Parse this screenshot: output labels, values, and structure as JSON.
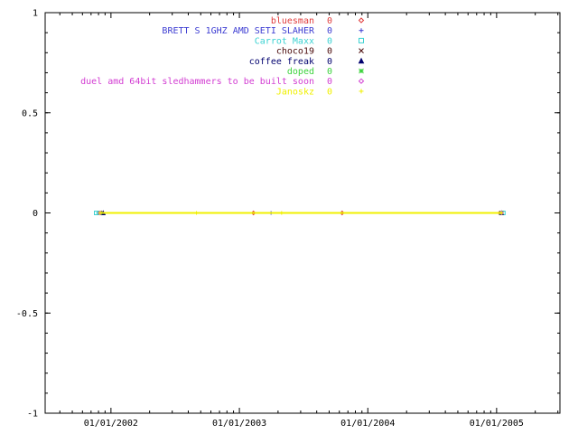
{
  "chart_data": {
    "type": "line",
    "title": "",
    "xlabel": "",
    "ylabel": "",
    "x_axis_type": "date",
    "x_range": [
      "2001-06-28",
      "2005-06-30"
    ],
    "ylim": [
      -1,
      1
    ],
    "grid": false,
    "legend_position": "top-right",
    "y_ticks": [
      {
        "value": 1,
        "label": "1"
      },
      {
        "value": 0.5,
        "label": "0.5"
      },
      {
        "value": 0,
        "label": "0"
      },
      {
        "value": -0.5,
        "label": "-0.5"
      },
      {
        "value": -1,
        "label": "-1"
      }
    ],
    "x_ticks": [
      {
        "date": "2002-01-01",
        "label": "01/01/2002"
      },
      {
        "date": "2003-01-01",
        "label": "01/01/2003"
      },
      {
        "date": "2004-01-01",
        "label": "01/01/2004"
      },
      {
        "date": "2005-01-01",
        "label": "01/01/2005"
      }
    ],
    "series": [
      {
        "name": "bluesman",
        "value_label": "0",
        "color": "#e03c3c",
        "marker": "diamond",
        "points": [
          [
            "2001-12-05",
            0
          ],
          [
            "2003-02-10",
            0
          ],
          [
            "2003-10-20",
            0
          ],
          [
            "2005-01-10",
            0
          ]
        ]
      },
      {
        "name": "BRETT  S 1GHZ AMD SETI SLAHER",
        "value_label": "0",
        "color": "#3c3cd2",
        "marker": "plus",
        "points": [
          [
            "2001-12-05",
            0
          ],
          [
            "2003-04-01",
            0
          ],
          [
            "2005-01-10",
            0
          ]
        ]
      },
      {
        "name": "Carrot Maxx",
        "value_label": "0",
        "color": "#3cd2d2",
        "marker": "square",
        "points": [
          [
            "2001-11-20",
            0
          ],
          [
            "2005-01-20",
            0
          ]
        ]
      },
      {
        "name": "choco19",
        "value_label": "0",
        "color": "#4a0a0a",
        "marker": "cross",
        "points": [
          [
            "2001-12-01",
            0
          ],
          [
            "2005-01-15",
            0
          ]
        ]
      },
      {
        "name": "coffee freak",
        "value_label": "0",
        "color": "#00006e",
        "marker": "triangle",
        "points": [
          [
            "2001-12-10",
            0
          ],
          [
            "2005-01-15",
            0
          ]
        ]
      },
      {
        "name": "doped",
        "value_label": "0",
        "color": "#3cd23c",
        "marker": "star",
        "points": [
          [
            "2001-12-01",
            0
          ],
          [
            "2005-01-15",
            0
          ]
        ]
      },
      {
        "name": "duel amd 64bit sledhammers to be built soon",
        "value_label": "0",
        "color": "#d23cd2",
        "marker": "diamond",
        "points": [
          [
            "2001-12-01",
            0
          ],
          [
            "2005-01-15",
            0
          ]
        ]
      },
      {
        "name": "Janoskz",
        "value_label": "0",
        "color": "#f0f000",
        "marker": "plus",
        "points": [
          [
            "2001-12-01",
            0
          ],
          [
            "2002-09-01",
            0
          ],
          [
            "2003-05-01",
            0
          ],
          [
            "2005-01-15",
            0
          ]
        ]
      }
    ]
  }
}
